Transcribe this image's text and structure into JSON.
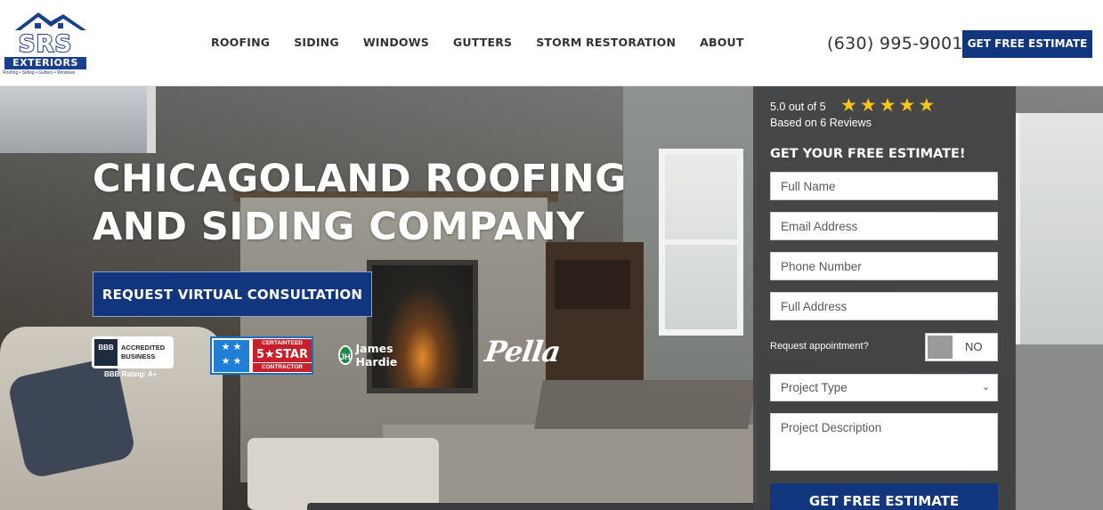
{
  "header": {
    "logo": {
      "brand": "SRS",
      "sub": "EXTERIORS",
      "tagline": "Roofing • Siding • Gutters • Windows"
    },
    "nav": [
      "ROOFING",
      "SIDING",
      "WINDOWS",
      "GUTTERS",
      "STORM RESTORATION",
      "ABOUT"
    ],
    "phone": "(630) 995-9001",
    "cta": "GET FREE ESTIMATE"
  },
  "hero": {
    "headline_line1": "CHICAGOLAND ROOFING",
    "headline_line2": "AND SIDING COMPANY",
    "cta": "REQUEST VIRTUAL CONSULTATION",
    "badges": {
      "bbb_seal": "BBB",
      "bbb_text_line1": "ACCREDITED",
      "bbb_text_line2": "BUSINESS",
      "bbb_rating": "BBB Rating: A+",
      "ct_top": "CERTAINTEED",
      "ct_mid": "5★STAR",
      "ct_bot": "CONTRACTOR",
      "jh_mark": "JH",
      "jh_text": "James Hardie",
      "pella": "Pella"
    }
  },
  "form": {
    "rating_line1": "5.0 out of 5",
    "rating_line2": "Based on 6 Reviews",
    "star_count": 5,
    "title": "GET YOUR FREE ESTIMATE!",
    "full_name_placeholder": "Full Name",
    "email_placeholder": "Email Address",
    "phone_placeholder": "Phone Number",
    "address_placeholder": "Full Address",
    "appointment_label": "Request appointment?",
    "appointment_value": "NO",
    "project_type": "Project Type",
    "description_placeholder": "Project Description",
    "submit": "GET FREE ESTIMATE"
  },
  "colors": {
    "brand_blue": "#12367e",
    "star_gold": "#f5c518",
    "panel_bg": "#424244"
  }
}
